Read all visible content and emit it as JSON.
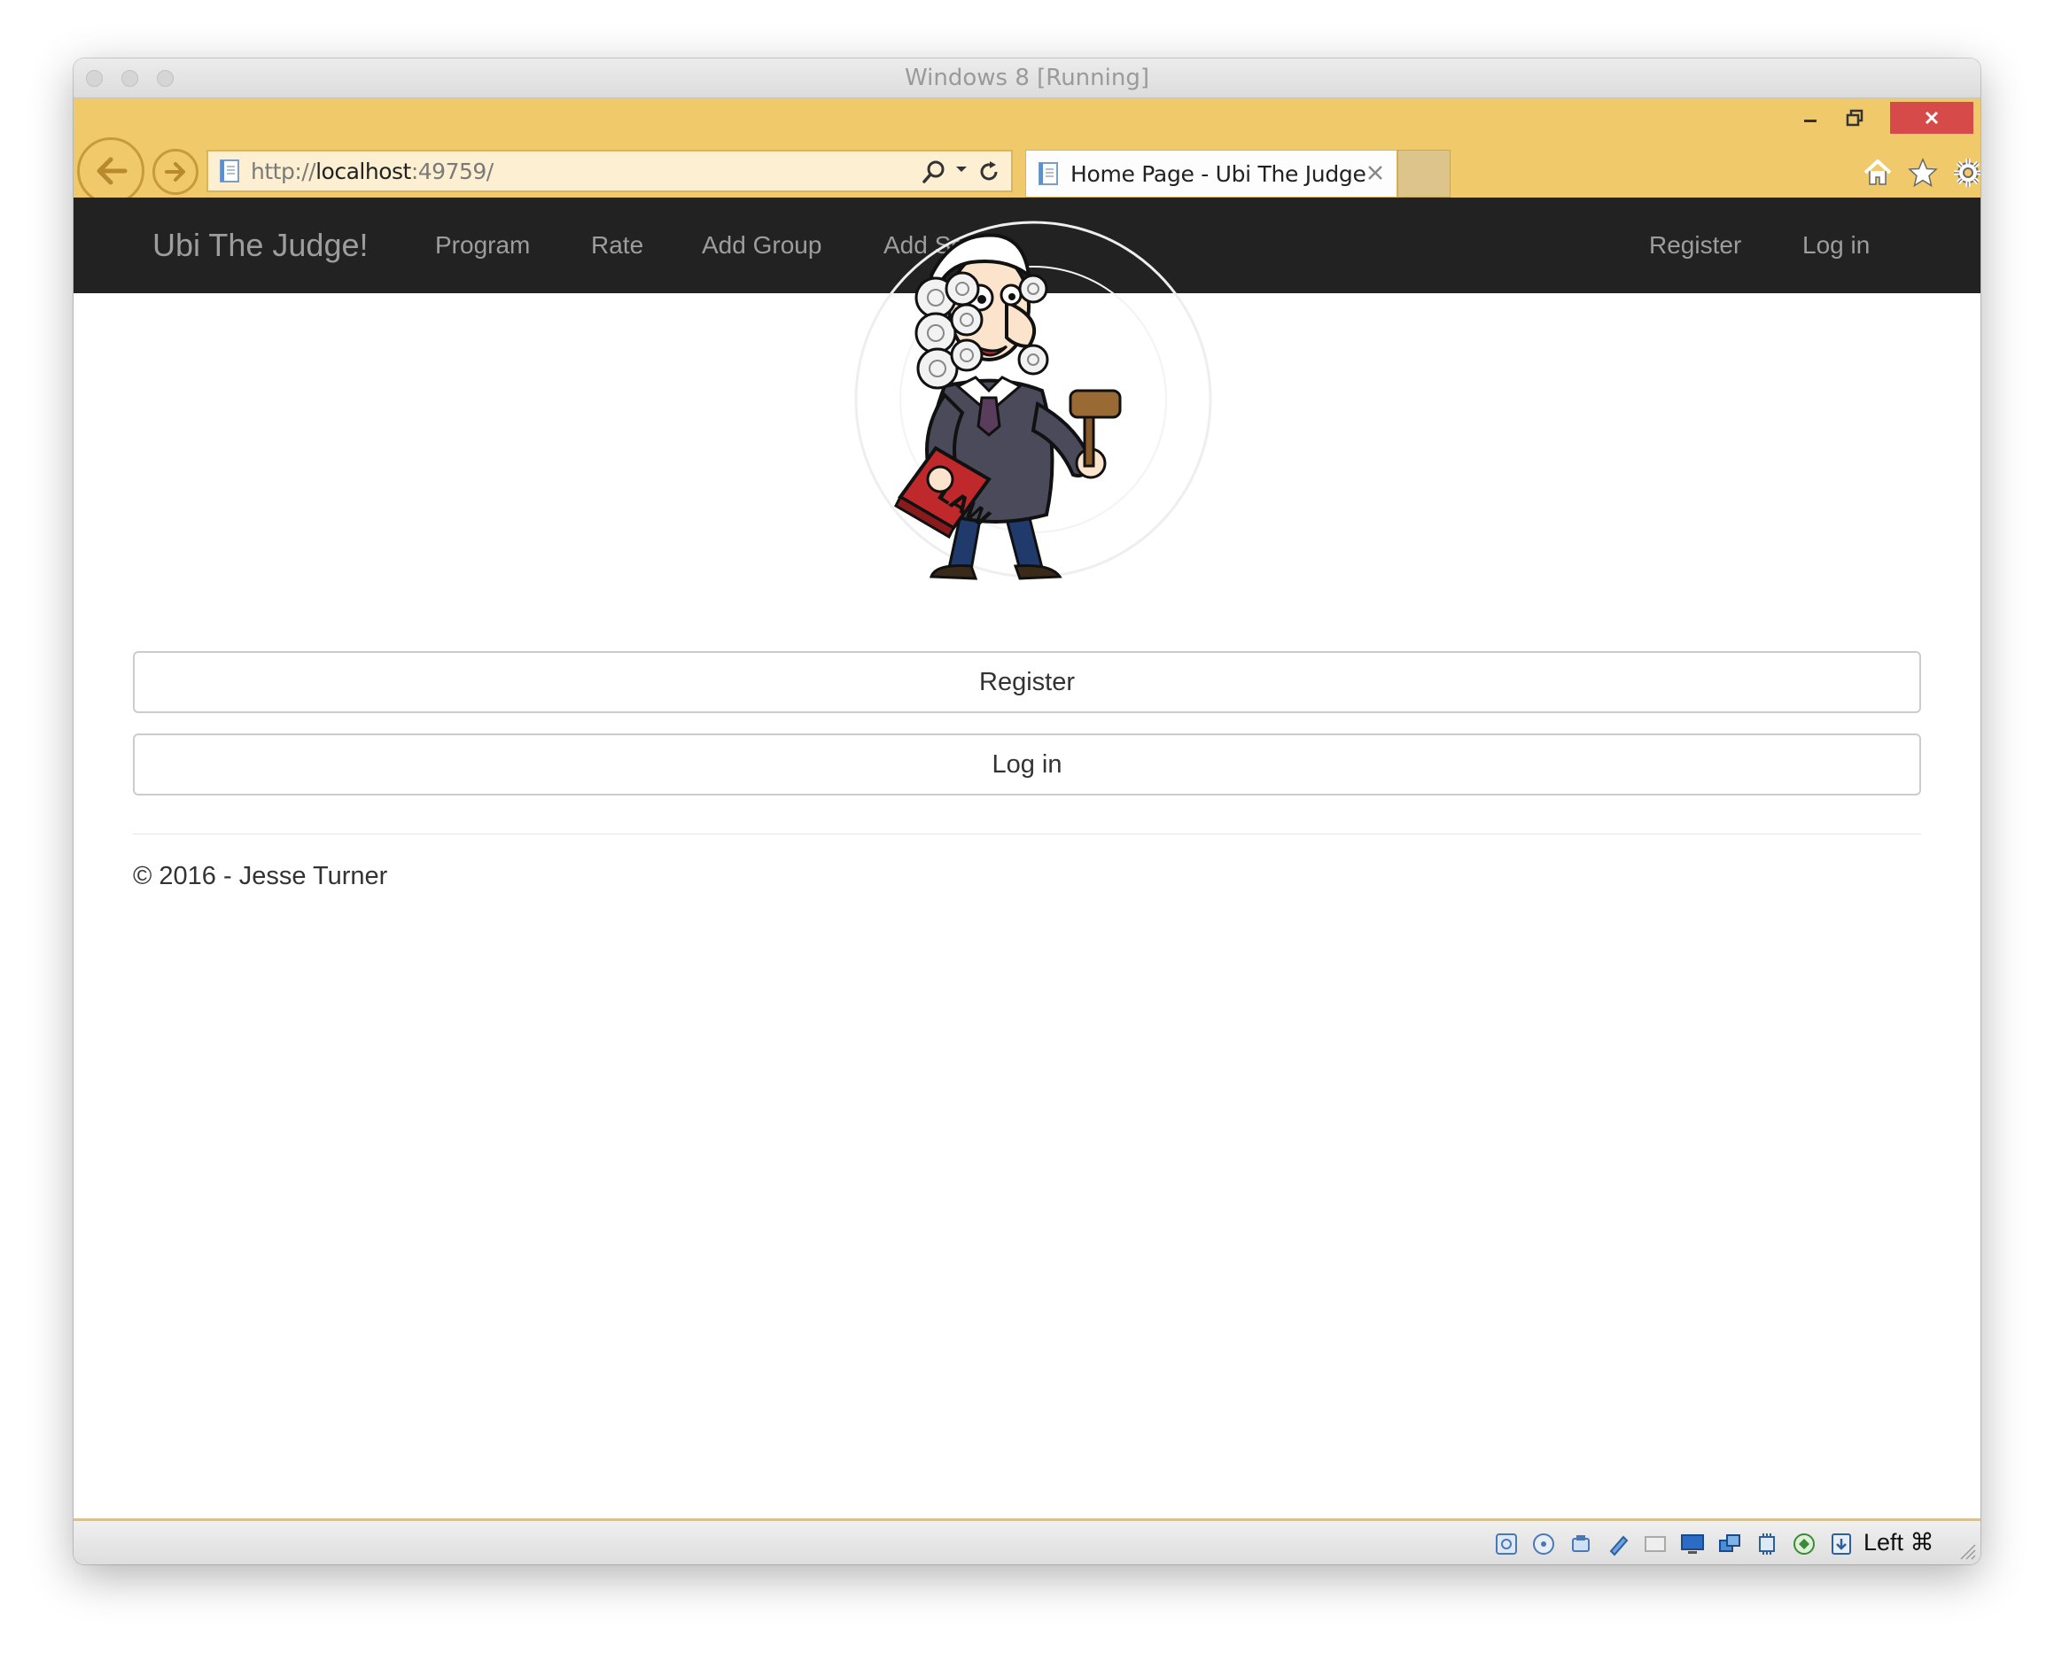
{
  "window": {
    "title": "Windows 8 [Running]"
  },
  "browser": {
    "address": {
      "scheme": "http://",
      "host": "localhost",
      "port": ":49759/"
    },
    "tab": {
      "title": "Home Page - Ubi The Judge"
    },
    "icons": [
      "back-icon",
      "forward-icon",
      "page-icon",
      "search-icon",
      "refresh-icon",
      "close-tab-icon",
      "home-icon",
      "star-icon",
      "gear-icon",
      "minimize-icon",
      "restore-icon",
      "close-icon"
    ],
    "accent_color": "#f0c96b",
    "close_color": "#d64a4a"
  },
  "navbar": {
    "brand": "Ubi The Judge!",
    "links": [
      "Program",
      "Rate",
      "Add Group",
      "Add Song"
    ],
    "right_links": [
      "Register",
      "Log in"
    ],
    "background": "#222222",
    "text_color": "#9d9d9d"
  },
  "logo": {
    "book_text": "LAW"
  },
  "main": {
    "register_button": "Register",
    "login_button": "Log in"
  },
  "footer": {
    "text": "© 2016 - Jesse Turner"
  },
  "statusbar": {
    "host_key": "Left ⌘"
  }
}
